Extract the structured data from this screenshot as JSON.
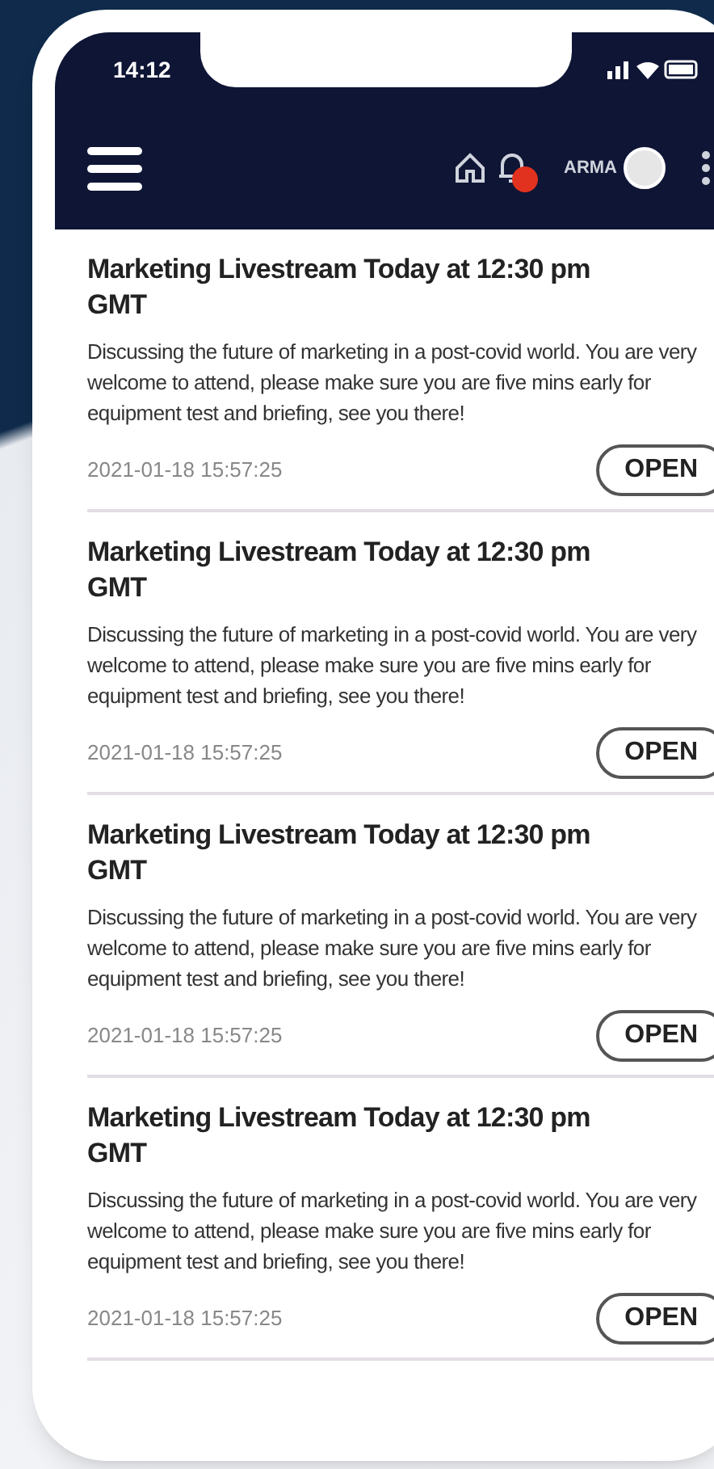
{
  "status_bar": {
    "time": "14:12"
  },
  "header": {
    "user": "ARMA",
    "notification_badge": true
  },
  "notifications": [
    {
      "title": "Marketing Livestream Today at 12:30 pm GMT",
      "body": "Discussing the future of marketing in a post-covid world. You are very welcome to attend, please make sure you are five mins early for equipment test and briefing, see you there!",
      "timestamp": "2021-01-18 15:57:25",
      "action": "OPEN"
    },
    {
      "title": "Marketing Livestream Today at 12:30 pm GMT",
      "body": "Discussing the future of marketing in a post-covid world. You are very welcome to attend, please make sure you are five mins early for equipment test and briefing, see you there!",
      "timestamp": "2021-01-18 15:57:25",
      "action": "OPEN"
    },
    {
      "title": "Marketing Livestream Today at 12:30 pm GMT",
      "body": "Discussing the future of marketing in a post-covid world. You are very welcome to attend, please make sure you are five mins early for equipment test and briefing, see you there!",
      "timestamp": "2021-01-18 15:57:25",
      "action": "OPEN"
    },
    {
      "title": "Marketing Livestream Today at 12:30 pm GMT",
      "body": "Discussing the future of marketing in a post-covid world. You are very welcome to attend, please make sure you are five mins early for equipment test and briefing, see you there!",
      "timestamp": "2021-01-18 15:57:25",
      "action": "OPEN"
    }
  ]
}
